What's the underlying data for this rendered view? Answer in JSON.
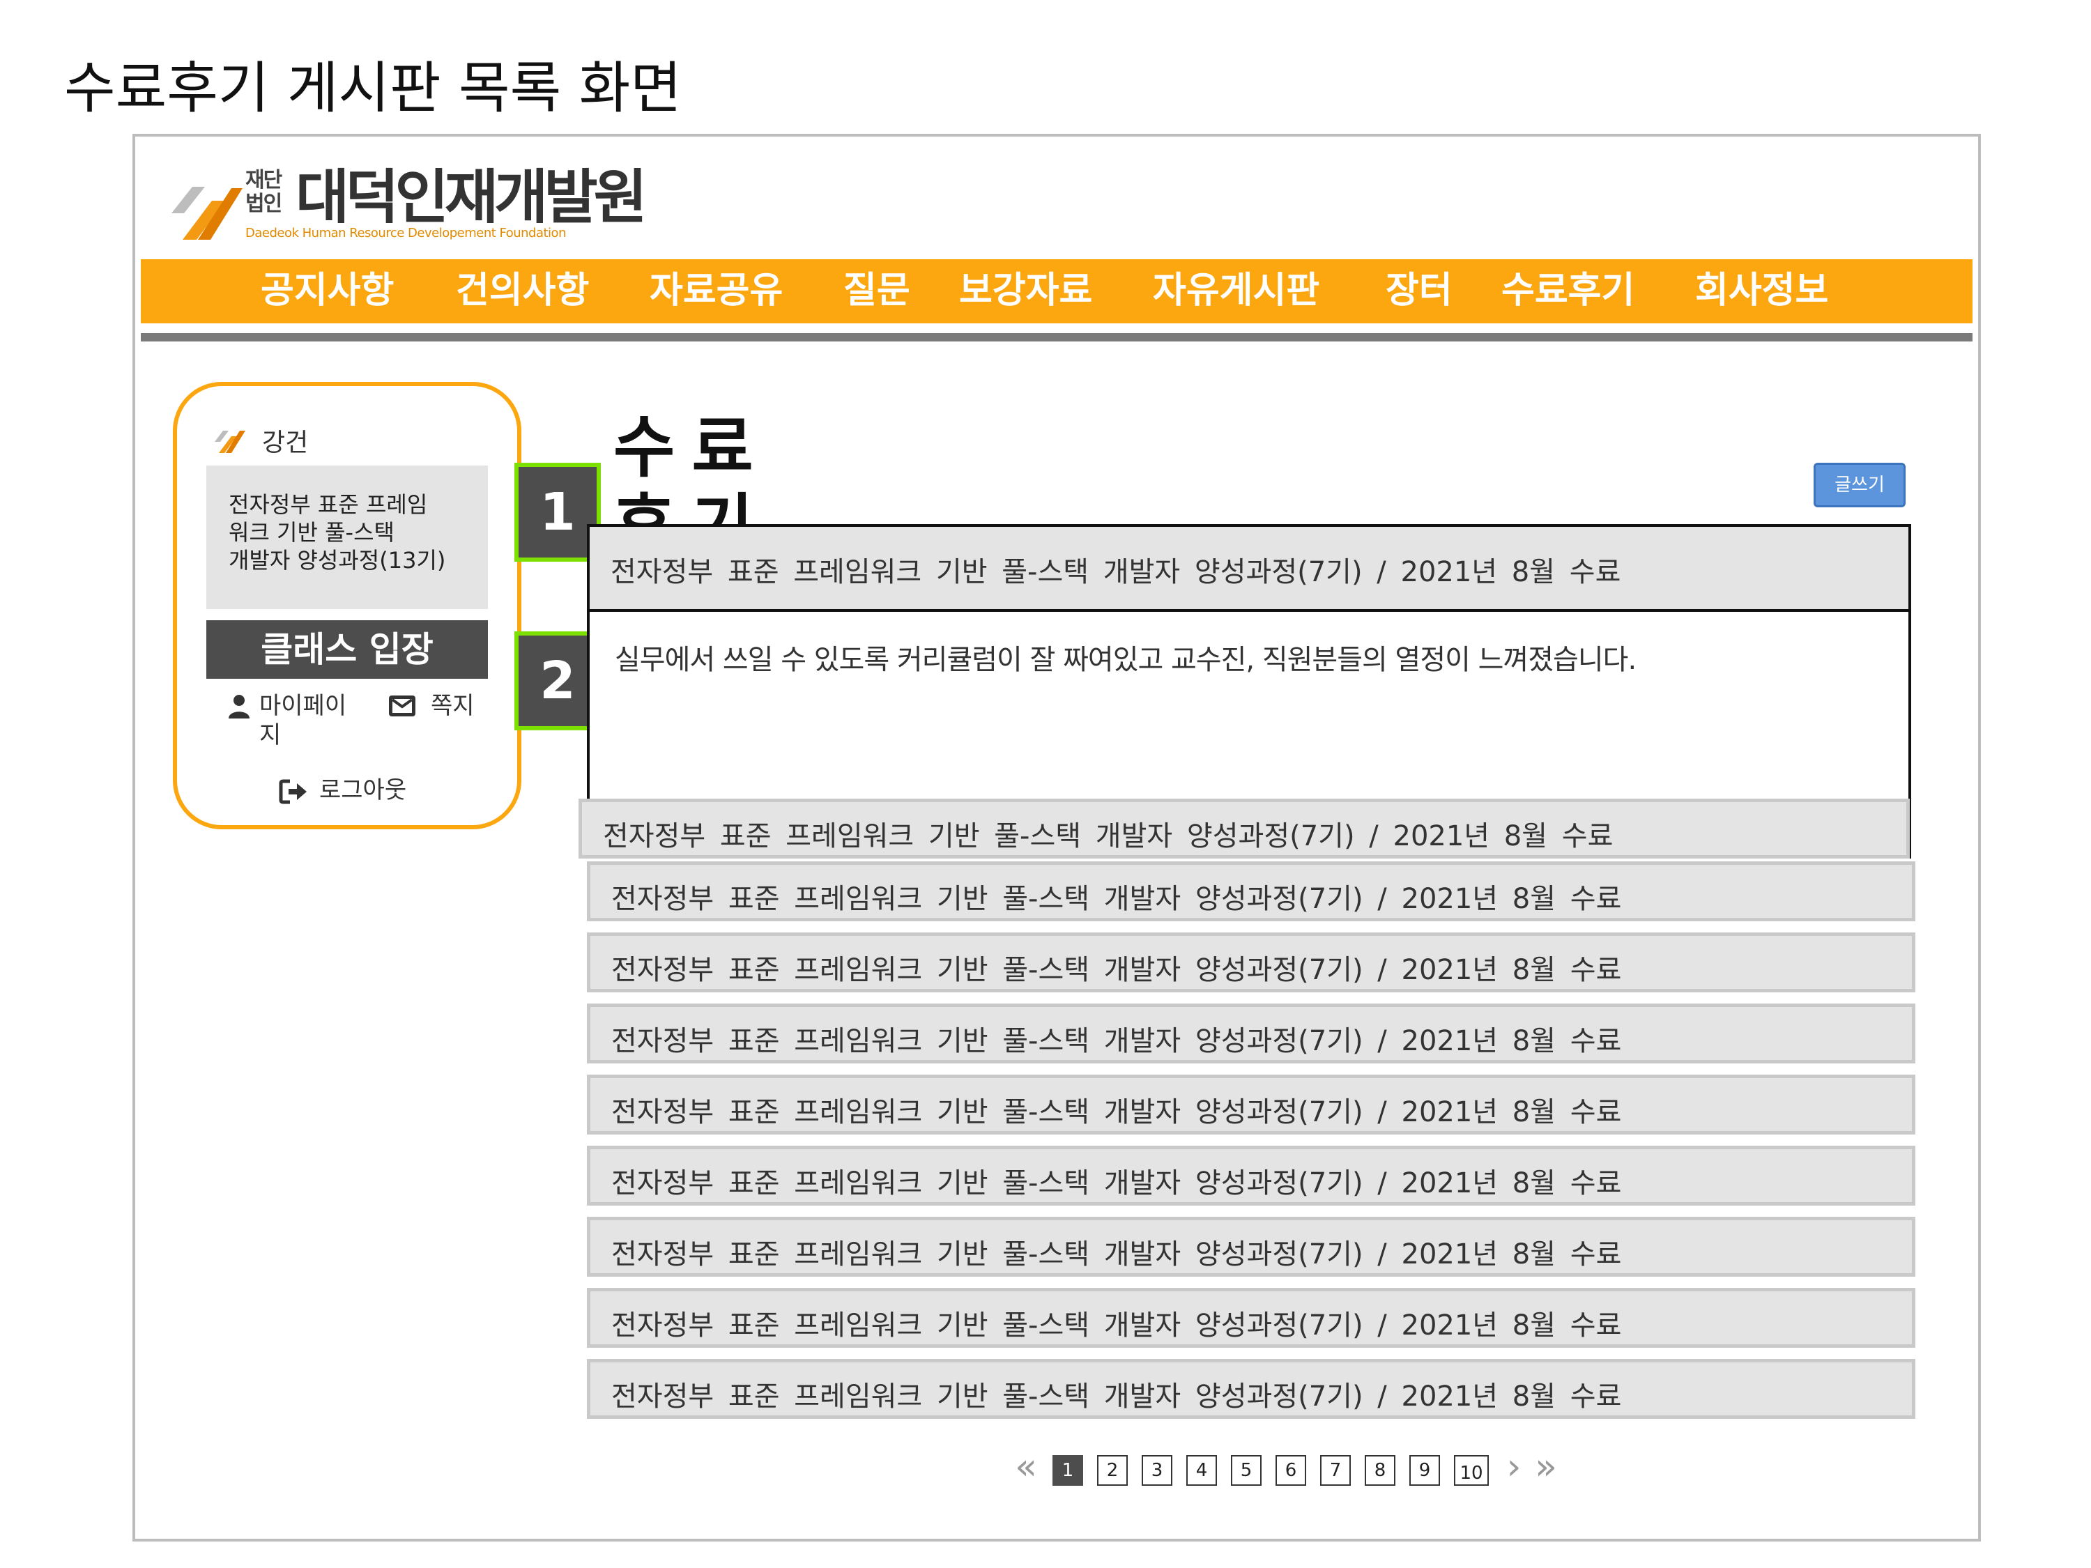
{
  "doc_title": "수료후기 게시판 목록 화면",
  "logo": {
    "corp_type": "재단법인",
    "name": "대덕인재개발원",
    "subtitle": "Daedeok Human Resource Developement Foundation",
    "mark_colors": [
      "#f39a12",
      "#bdbdbd"
    ]
  },
  "nav": {
    "items": [
      {
        "label": "공지사항"
      },
      {
        "label": "건의사항"
      },
      {
        "label": "자료공유"
      },
      {
        "label": "질문"
      },
      {
        "label": "보강자료"
      },
      {
        "label": "자유게시판"
      },
      {
        "label": "장터"
      },
      {
        "label": "수료후기"
      },
      {
        "label": "회사정보"
      }
    ],
    "bar_color": "#fca610"
  },
  "sidebar": {
    "lecture_label": "강건",
    "course_name": "전자정부 표준 프레임워크 기반 풀-스택 개발자 양성과정(13기)",
    "course_lines": [
      "전자정부 표준 프레임",
      "워크 기반 풀-스택",
      "개발자 양성과정(13기)"
    ],
    "class_button": "클래스 입장",
    "mypage_label": "마이페이지",
    "message_label": "쪽지",
    "logout_label": "로그아웃",
    "icons": {
      "lecture": "orange-logo-icon",
      "mypage": "user-icon",
      "message": "envelope-icon",
      "logout": "sign-out-icon"
    }
  },
  "callouts": [
    "1",
    "2"
  ],
  "main": {
    "heading": "수료 후기",
    "write_button": "글쓰기",
    "expanded_post": {
      "title": "전자정부 표준 프레임워크 기반 풀-스택 개발자 양성과정(7기) / 2021년 8월 수료",
      "body": "실무에서 쓰일 수 있도록 커리큘럼이 잘 짜여있고 교수진, 직원분들의 열정이 느껴졌습니다."
    },
    "rows": [
      "전자정부 표준 프레임워크 기반 풀-스택 개발자 양성과정(7기) / 2021년 8월 수료",
      "전자정부 표준 프레임워크 기반 풀-스택 개발자 양성과정(7기) / 2021년 8월 수료",
      "전자정부 표준 프레임워크 기반 풀-스택 개발자 양성과정(7기) / 2021년 8월 수료",
      "전자정부 표준 프레임워크 기반 풀-스택 개발자 양성과정(7기) / 2021년 8월 수료",
      "전자정부 표준 프레임워크 기반 풀-스택 개발자 양성과정(7기) / 2021년 8월 수료",
      "전자정부 표준 프레임워크 기반 풀-스택 개발자 양성과정(7기) / 2021년 8월 수료",
      "전자정부 표준 프레임워크 기반 풀-스택 개발자 양성과정(7기) / 2021년 8월 수료",
      "전자정부 표준 프레임워크 기반 풀-스택 개발자 양성과정(7기) / 2021년 8월 수료",
      "전자정부 표준 프레임워크 기반 풀-스택 개발자 양성과정(7기) / 2021년 8월 수료"
    ]
  },
  "pagination": {
    "first": "«",
    "prev": "‹",
    "next": "›",
    "last": "»",
    "pages": [
      "1",
      "2",
      "3",
      "4",
      "5",
      "6",
      "7",
      "8",
      "9",
      "10"
    ],
    "current": "1"
  }
}
